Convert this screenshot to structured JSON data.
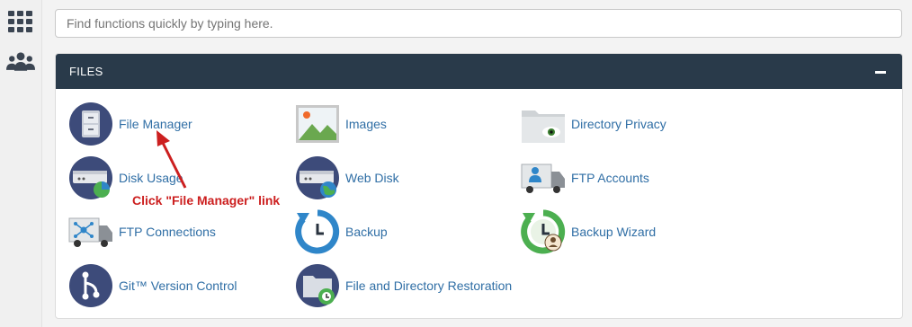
{
  "search": {
    "placeholder": "Find functions quickly by typing here."
  },
  "sidebar": {
    "icons": [
      "grid-icon",
      "users-icon"
    ]
  },
  "panel": {
    "title": "FILES",
    "items": [
      {
        "label": "File Manager",
        "icon": "file-manager-icon"
      },
      {
        "label": "Images",
        "icon": "images-icon"
      },
      {
        "label": "Directory Privacy",
        "icon": "directory-privacy-icon"
      },
      {
        "label": "Disk Usage",
        "icon": "disk-usage-icon"
      },
      {
        "label": "Web Disk",
        "icon": "web-disk-icon"
      },
      {
        "label": "FTP Accounts",
        "icon": "ftp-accounts-icon"
      },
      {
        "label": "FTP Connections",
        "icon": "ftp-connections-icon"
      },
      {
        "label": "Backup",
        "icon": "backup-icon"
      },
      {
        "label": "Backup Wizard",
        "icon": "backup-wizard-icon"
      },
      {
        "label": "Git™ Version Control",
        "icon": "git-icon"
      },
      {
        "label": "File and Directory Restoration",
        "icon": "file-restoration-icon"
      }
    ]
  },
  "annotation": {
    "text": "Click \"File Manager\" link",
    "color": "#cc1f1f"
  },
  "colors": {
    "header_bg": "#293a4a",
    "link": "#2f6ea5",
    "icon_navy": "#3d4b7a",
    "icon_blue": "#2f86c9",
    "icon_green": "#4caf50"
  }
}
